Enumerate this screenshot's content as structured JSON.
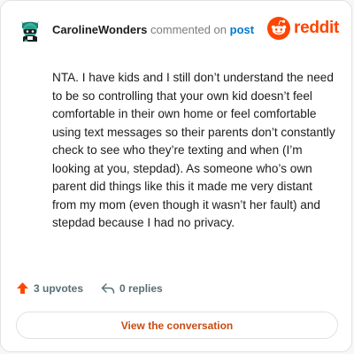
{
  "comment": {
    "username": "CarolineWonders",
    "action_text": "commented on",
    "post_link": "post",
    "body": "NTA. I have kids and I still don’t understand the need to be so controlling that your own kid doesn’t feel comfortable in their own home or feel comfortable using text messages so their parents don’t constantly check to see who they’re texting and when (I’m looking at you, stepdad). As someone who’s own parent did things like this it made me very distant from my mom (even though it wasn’t her fault) and stepdad because I had no privacy."
  },
  "brand": {
    "name": "reddit",
    "color": "#ff4500"
  },
  "stats": {
    "upvotes_label": "3 upvotes",
    "replies_label": "0 replies"
  },
  "cta": {
    "label": "View the conversation"
  },
  "icons": {
    "avatar": "snoo-avatar-icon",
    "logo": "reddit-snoo-icon",
    "upvote": "upvote-arrow-icon",
    "reply": "reply-arrow-icon"
  }
}
